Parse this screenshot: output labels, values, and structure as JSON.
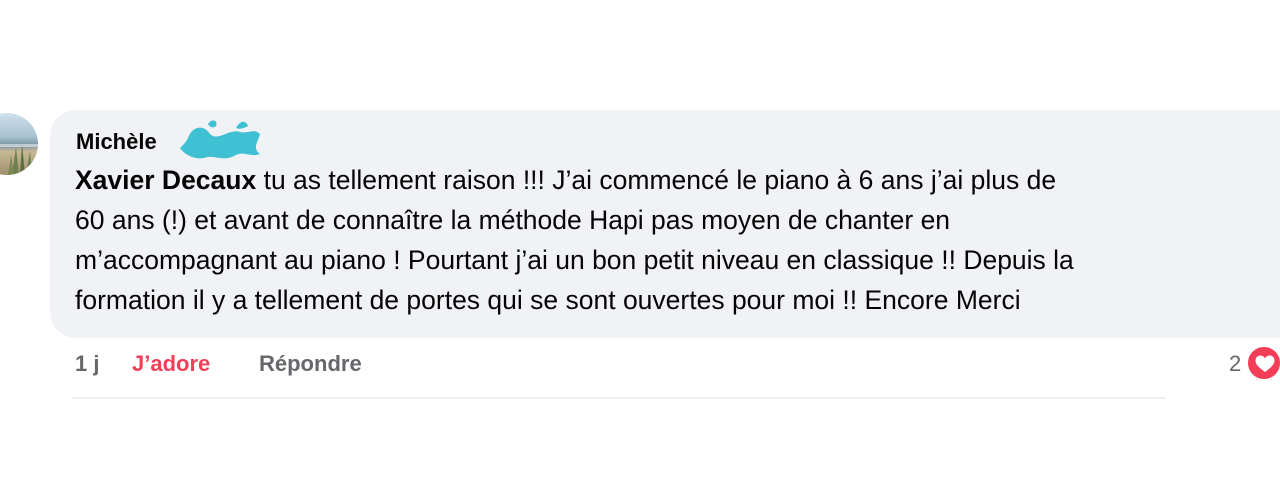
{
  "comment": {
    "author": "Michèle",
    "mention": "Xavier Decaux",
    "text_lines": [
      " tu as tellement raison !!! J’ai commencé le piano à 6 ans j’ai plus de",
      "60 ans (!) et avant de connaître la méthode Hapi pas moyen de chanter en",
      "m’accompagnant au piano ! Pourtant j’ai un bon petit niveau en classique !! Depuis la",
      "formation il y a tellement de portes qui se sont ouvertes pour moi !! Encore Merci"
    ]
  },
  "actions": {
    "time": "1 j",
    "love_label": "J’adore",
    "reply_label": "Répondre"
  },
  "reactions": {
    "count": "2",
    "icon": "heart-icon"
  },
  "colors": {
    "bubble_bg": "#f0f2f5",
    "love": "#f33e58",
    "muted": "#65676b",
    "redaction": "#3fc1d3"
  }
}
